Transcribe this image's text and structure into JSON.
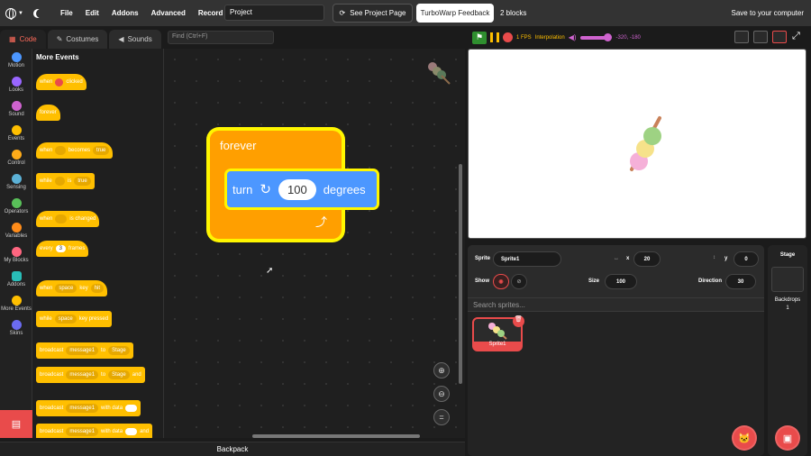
{
  "menubar": {
    "items": [
      "File",
      "Edit",
      "Addons",
      "Advanced",
      "Record"
    ],
    "project_title": "Project",
    "see_project_page": "See Project Page",
    "feedback": "TurboWarp Feedback",
    "blocks_count": "2 blocks",
    "save": "Save to your computer"
  },
  "editor_tabs": {
    "code": "Code",
    "costumes": "Costumes",
    "sounds": "Sounds"
  },
  "find_placeholder": "Find (Ctrl+F)",
  "categories": [
    {
      "label": "Motion",
      "color": "#4c97ff"
    },
    {
      "label": "Looks",
      "color": "#9966ff"
    },
    {
      "label": "Sound",
      "color": "#cf63cf"
    },
    {
      "label": "Events",
      "color": "#ffbf00"
    },
    {
      "label": "Control",
      "color": "#ffab19"
    },
    {
      "label": "Sensing",
      "color": "#5cb1d6"
    },
    {
      "label": "Operators",
      "color": "#59c059"
    },
    {
      "label": "Variables",
      "color": "#ff8c1a"
    },
    {
      "label": "My Blocks",
      "color": "#ff6680"
    },
    {
      "label": "Addons",
      "color": "#29beb8"
    },
    {
      "label": "More Events",
      "color": "#ffbf00"
    },
    {
      "label": "Skins",
      "color": "#6b6bf0"
    }
  ],
  "palette": {
    "title": "More Events",
    "when": "when",
    "clicked": "clicked",
    "forever": "forever",
    "becomes": "becomes",
    "true_val": "true",
    "while": "while",
    "is": "is",
    "is_changed": "is changed",
    "every": "every",
    "three": "3",
    "frames": "frames",
    "space": "space",
    "key": "key",
    "hit": "hit",
    "key_pressed": "key pressed",
    "broadcast": "broadcast",
    "message1": "message1",
    "to": "to",
    "stage": "Stage",
    "and": "and",
    "with_data": "with data"
  },
  "script": {
    "forever": "forever",
    "turn": "turn",
    "value": "100",
    "degrees": "degrees"
  },
  "backpack": "Backpack",
  "stage_controls": {
    "fps": "1 FPS",
    "interpolation": "Interpolation",
    "coords": "-320, -180"
  },
  "sprite_info": {
    "sprite_label": "Sprite",
    "sprite_name": "Sprite1",
    "x_label": "x",
    "x": "20",
    "y_label": "y",
    "y": "0",
    "show_label": "Show",
    "size_label": "Size",
    "size": "100",
    "direction_label": "Direction",
    "direction": "30"
  },
  "search_sprites": "Search sprites...",
  "sprite_tile_name": "Sprite1",
  "stage_panel": {
    "title": "Stage",
    "backdrops_label": "Backdrops",
    "backdrops_count": "1"
  }
}
